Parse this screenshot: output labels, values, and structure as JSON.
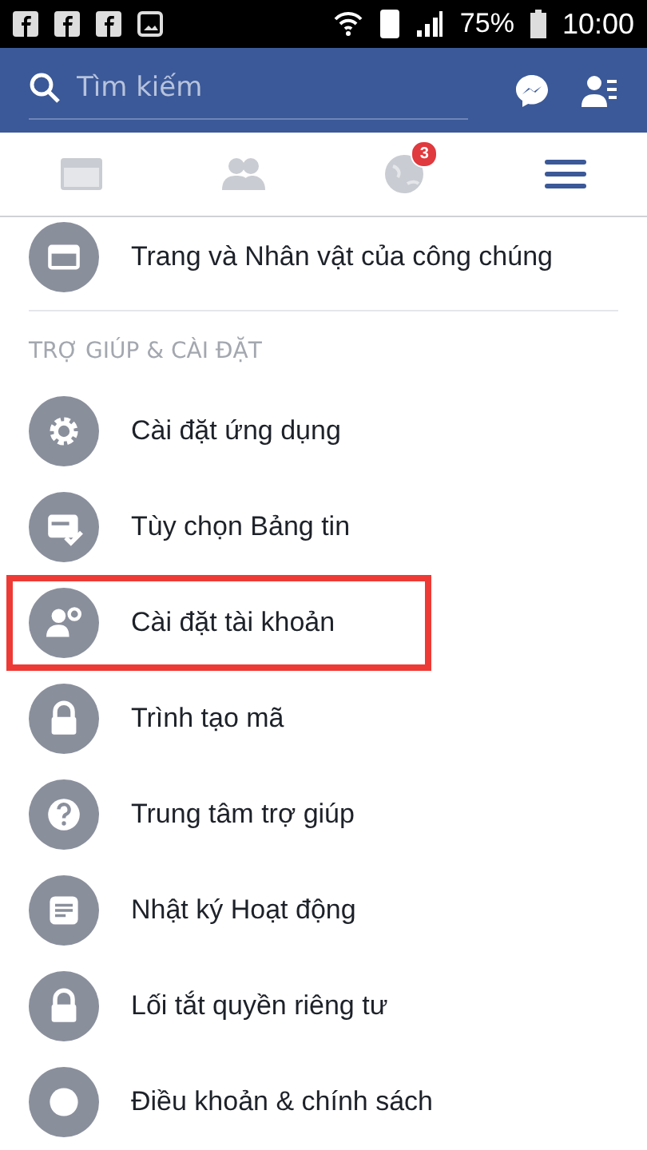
{
  "status_bar": {
    "notifications": [
      {
        "kind": "app"
      },
      {
        "kind": "app"
      },
      {
        "kind": "app"
      },
      {
        "kind": "image"
      }
    ],
    "battery": "75%",
    "time": "10:00"
  },
  "header": {
    "search": {
      "placeholder": "Tìm kiếm"
    }
  },
  "tabs": [
    {
      "kind": "feed",
      "selected": false
    },
    {
      "kind": "friends",
      "selected": false
    },
    {
      "kind": "globe",
      "selected": false,
      "badge": "3"
    },
    {
      "kind": "menu",
      "selected": true
    }
  ],
  "top_items": [
    {
      "kind": "page",
      "label": "Trang và Nhân vật của công chúng",
      "highlighted": false
    }
  ],
  "section": {
    "title": "TRỢ GIÚP & CÀI ĐẶT",
    "items": [
      {
        "kind": "gear",
        "label": "Cài đặt ứng dụng",
        "highlighted": false
      },
      {
        "kind": "feed-check",
        "label": "Tùy chọn Bảng tin",
        "highlighted": false
      },
      {
        "kind": "user-gear",
        "label": "Cài đặt tài khoản",
        "highlighted": true
      },
      {
        "kind": "lock",
        "label": "Trình tạo mã",
        "highlighted": false
      },
      {
        "kind": "question",
        "label": "Trung tâm trợ giúp",
        "highlighted": false
      },
      {
        "kind": "note",
        "label": "Nhật ký Hoạt động",
        "highlighted": false
      },
      {
        "kind": "lock",
        "label": "Lối tắt quyền riêng tư",
        "highlighted": false
      },
      {
        "kind": "badge",
        "label": "Điều khoản & chính sách",
        "highlighted": false
      }
    ]
  }
}
